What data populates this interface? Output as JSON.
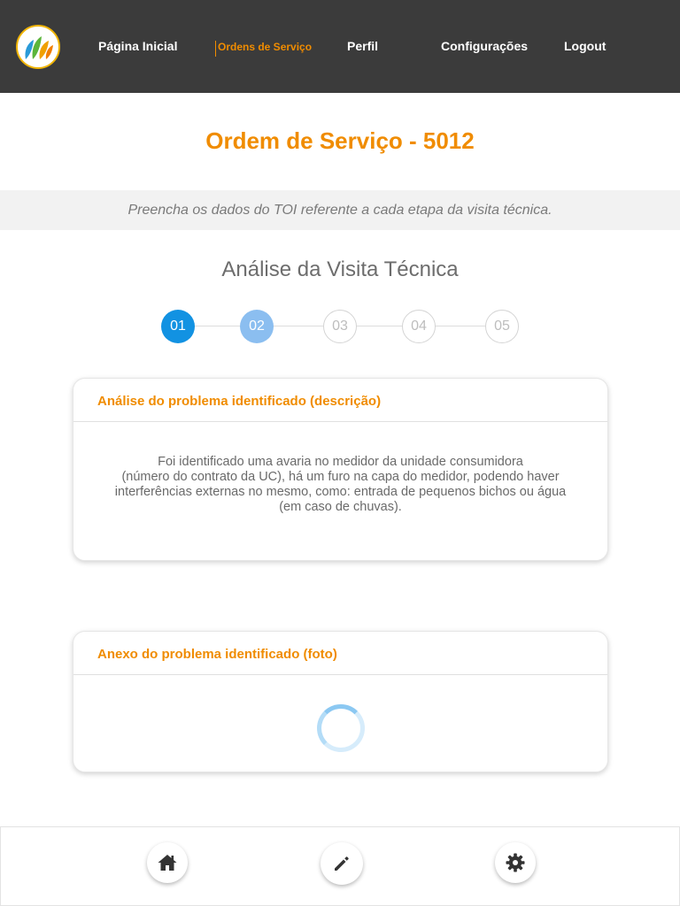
{
  "nav": {
    "items": [
      {
        "label": "Página Inicial",
        "active": false
      },
      {
        "label": "Ordens de Serviço",
        "active": true
      },
      {
        "label": "Perfil",
        "active": false
      },
      {
        "label": "Configurações",
        "active": false
      },
      {
        "label": "Logout",
        "active": false
      }
    ]
  },
  "page": {
    "title": "Ordem de Serviço - 5012",
    "subtitle": "Preencha os dados do TOI referente a cada etapa da visita técnica.",
    "section_title": "Análise da Visita Técnica"
  },
  "stepper": {
    "steps": [
      "01",
      "02",
      "03",
      "04",
      "05"
    ],
    "completed": 1,
    "current": 2
  },
  "cards": {
    "description": {
      "header": "Análise do problema identificado (descrição)",
      "lines": [
        "Foi identificado uma avaria no medidor da unidade consumidora",
        "(número do contrato da UC), há um furo na capa do medidor, podendo haver",
        "interferências externas no mesmo, como: entrada de pequenos bichos ou água",
        "(em caso de chuvas)."
      ]
    },
    "attachment": {
      "header": "Anexo do problema identificado (foto)",
      "loading": true
    }
  },
  "bottom_bar": {
    "buttons": [
      "home-icon",
      "pencil-icon",
      "gear-icon"
    ]
  },
  "colors": {
    "topbar": "#3b3b3b",
    "accent": "#f08c00",
    "step_done": "#1292e2",
    "step_current": "#8bbef0"
  }
}
